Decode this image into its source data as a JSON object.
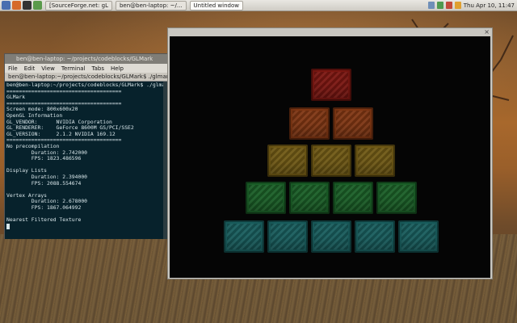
{
  "panel": {
    "tasks": [
      {
        "label": "[SourceForge.net: gL",
        "active": false
      },
      {
        "label": "ben@ben-laptop: ~/...",
        "active": false
      },
      {
        "label": "Untitled window",
        "active": true
      }
    ],
    "clock": "Thu Apr 10, 11:47"
  },
  "terminal": {
    "title": "ben@ben-laptop: ~/projects/codeblocks/GLMark",
    "menu": [
      "File",
      "Edit",
      "View",
      "Terminal",
      "Tabs",
      "Help"
    ],
    "tab_label": "ben@ben-laptop:~/projects/codeblocks/GLMark$ ./glmark",
    "lines": [
      "ben@ben-laptop:~/projects/codeblocks/GLMark$ ./glmark",
      "=====================================",
      "GLMark",
      "=====================================",
      "Screen mode: 800x600x20",
      "OpenGL Information",
      "GL_VENDOR:      NVIDIA Corporation",
      "GL_RENDERER:    GeForce 8600M GS/PCI/SSE2",
      "GL_VERSION:     2.1.2 NVIDIA 169.12",
      "=====================================",
      "No precompilation",
      "        Duration: 2.742000",
      "        FPS: 1823.486596",
      "",
      "Display Lists",
      "        Duration: 2.394000",
      "        FPS: 2088.554674",
      "",
      "Vertex Arrays",
      "        Duration: 2.678000",
      "        FPS: 1867.064992",
      "",
      "Nearest Filtered Texture"
    ]
  },
  "gl_window": {
    "close_glyph": "×",
    "cube_colors": {
      "row1": "#8a1a14",
      "row2": "#8e3d16",
      "row3": "#7d6418",
      "row4": "#1e6a2c",
      "row5": "#1c6868"
    }
  }
}
